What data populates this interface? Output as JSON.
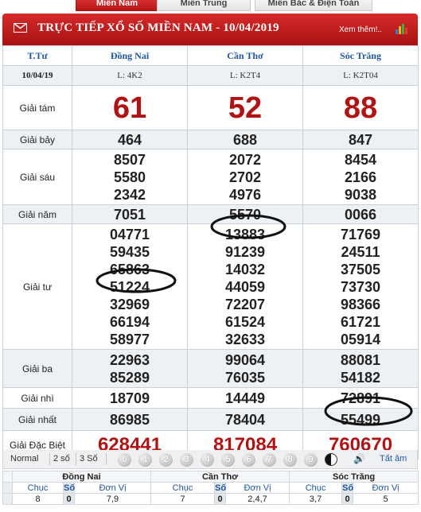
{
  "tabs": [
    {
      "label": "Miền Nam",
      "active": true
    },
    {
      "label": "Miền Trung",
      "active": false
    },
    {
      "label": "Miền Bắc & Điện Toán",
      "active": false
    }
  ],
  "header": {
    "title": "TRỰC TIẾP XỔ SỐ MIỀN NAM - 10/04/2019",
    "more_link": "Xem thêm!..",
    "accent_color": "#c41e1e",
    "icons": [
      "mail-icon",
      "bar-chart-icon"
    ]
  },
  "table": {
    "col_header_label": "T.Tư",
    "date": "10/04/19",
    "provinces": [
      {
        "name": "Đồng Nai",
        "code": "L: 4K2"
      },
      {
        "name": "Cần Thơ",
        "code": "L: K2T4"
      },
      {
        "name": "Sóc Trăng",
        "code": "L: K2T04"
      }
    ],
    "prizes": [
      {
        "label": "Giải tám",
        "values": [
          [
            "61"
          ],
          [
            "52"
          ],
          [
            "88"
          ]
        ]
      },
      {
        "label": "Giải bảy",
        "values": [
          [
            "464"
          ],
          [
            "688"
          ],
          [
            "847"
          ]
        ]
      },
      {
        "label": "Giải sáu",
        "values": [
          [
            "8507",
            "5580",
            "2342"
          ],
          [
            "2072",
            "2702",
            "4976"
          ],
          [
            "8454",
            "2166",
            "9038"
          ]
        ]
      },
      {
        "label": "Giải năm",
        "values": [
          [
            "7051"
          ],
          [
            "5570"
          ],
          [
            "0066"
          ]
        ]
      },
      {
        "label": "Giải tư",
        "values": [
          [
            "04771",
            "59435",
            "65863",
            "51224",
            "32969",
            "66194",
            "58977"
          ],
          [
            "13883",
            "91239",
            "14032",
            "44059",
            "72207",
            "61524",
            "32633"
          ],
          [
            "71769",
            "24511",
            "37505",
            "73730",
            "98366",
            "61721",
            "05914"
          ]
        ]
      },
      {
        "label": "Giải ba",
        "values": [
          [
            "22963",
            "85289"
          ],
          [
            "99064",
            "76035"
          ],
          [
            "88081",
            "54182"
          ]
        ]
      },
      {
        "label": "Giải nhì",
        "values": [
          [
            "18709"
          ],
          [
            "14449"
          ],
          [
            "72891"
          ]
        ]
      },
      {
        "label": "Giải nhất",
        "values": [
          [
            "86985"
          ],
          [
            "78404"
          ],
          [
            "55499"
          ]
        ]
      },
      {
        "label": "Giải Đặc Biệt",
        "values": [
          [
            "628441"
          ],
          [
            "817084"
          ],
          [
            "760670"
          ]
        ]
      }
    ]
  },
  "toolbar": {
    "modes": [
      "Normal",
      "2 số",
      "3 Số"
    ],
    "digits": [
      "0",
      "1",
      "2",
      "3",
      "4",
      "5",
      "6",
      "7",
      "8",
      "9"
    ],
    "show_all": "Tất âm"
  },
  "stats": {
    "provinces": [
      "Đồng Nai",
      "Cần Thơ",
      "Sóc Trăng"
    ],
    "col_labels": [
      "Chục",
      "Số",
      "Đơn Vị"
    ],
    "rows": [
      [
        [
          "8",
          "0",
          "7,9"
        ],
        [
          "7",
          "0",
          "2,4,7"
        ],
        [
          "3,7",
          "0",
          "5"
        ]
      ]
    ]
  }
}
